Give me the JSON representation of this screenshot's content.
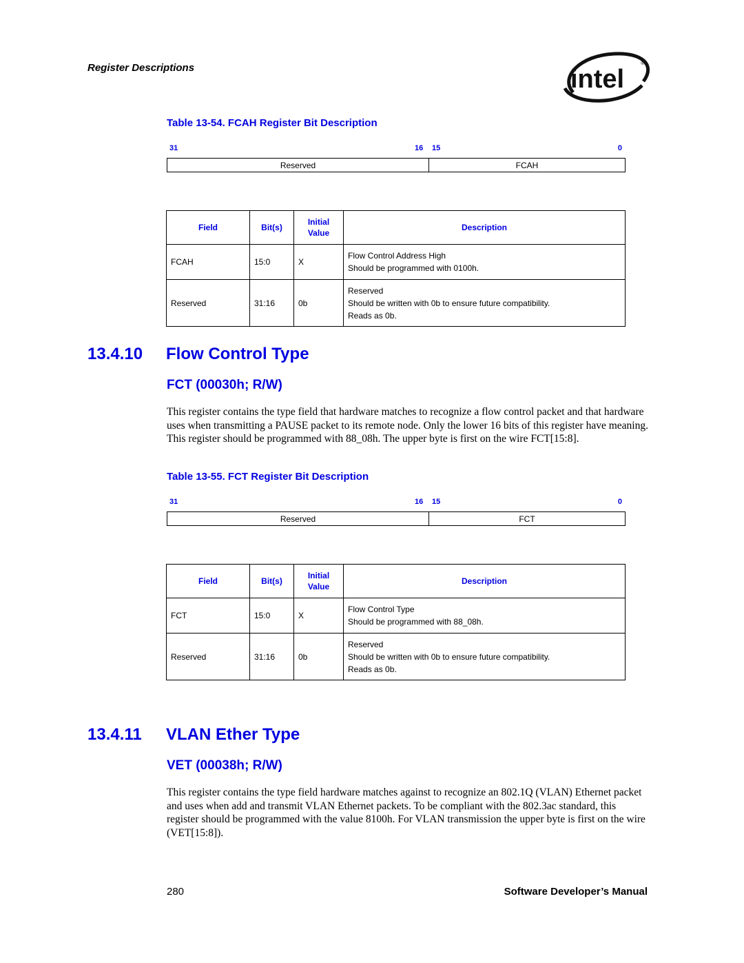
{
  "header": {
    "section": "Register Descriptions",
    "logo": "intel-logo"
  },
  "fcah_table": {
    "title": "Table 13-54. FCAH Register Bit Description",
    "bits": {
      "b31": "31",
      "b16": "16",
      "b15": "15",
      "b0": "0"
    },
    "reg_fields": {
      "upper": "Reserved",
      "lower": "FCAH"
    },
    "columns": [
      "Field",
      "Bit(s)",
      "Initial Value",
      "Description"
    ],
    "rows": [
      {
        "field": "FCAH",
        "bits": "15:0",
        "initial": "X",
        "desc": [
          "Flow Control Address High",
          "Should be programmed with 0100h."
        ]
      },
      {
        "field": "Reserved",
        "bits": "31:16",
        "initial": "0b",
        "desc": [
          "Reserved",
          "Should be written with 0b to ensure future compatibility.",
          "Reads as 0b."
        ]
      }
    ]
  },
  "section_fct": {
    "number": "13.4.10",
    "title": "Flow Control Type",
    "subtitle": "FCT (00030h; R/W)",
    "paragraph": "This register contains the type field that hardware matches to recognize a flow control packet and that hardware uses when transmitting a PAUSE packet to its remote node. Only the lower 16 bits of this register have meaning. This register should be programmed with 88_08h. The upper byte is first on the wire FCT[15:8]."
  },
  "fct_table": {
    "title": "Table 13-55. FCT Register Bit Description",
    "bits": {
      "b31": "31",
      "b16": "16",
      "b15": "15",
      "b0": "0"
    },
    "reg_fields": {
      "upper": "Reserved",
      "lower": "FCT"
    },
    "columns": [
      "Field",
      "Bit(s)",
      "Initial Value",
      "Description"
    ],
    "rows": [
      {
        "field": "FCT",
        "bits": "15:0",
        "initial": "X",
        "desc": [
          "Flow Control Type",
          "Should be programmed with 88_08h."
        ]
      },
      {
        "field": "Reserved",
        "bits": "31:16",
        "initial": "0b",
        "desc": [
          "Reserved",
          "Should be written with 0b to ensure future compatibility.",
          "Reads as 0b."
        ]
      }
    ]
  },
  "section_vet": {
    "number": "13.4.11",
    "title": "VLAN Ether Type",
    "subtitle": "VET (00038h; R/W)",
    "paragraph": "This register contains the type field hardware matches against to recognize an 802.1Q (VLAN) Ethernet packet and uses when add and transmit VLAN Ethernet packets. To be compliant with the 802.3ac standard, this register should be programmed with the value 8100h. For VLAN transmission the upper byte is first on the wire (VET[15:8])."
  },
  "footer": {
    "page_number": "280",
    "manual_title": "Software Developer’s Manual"
  }
}
